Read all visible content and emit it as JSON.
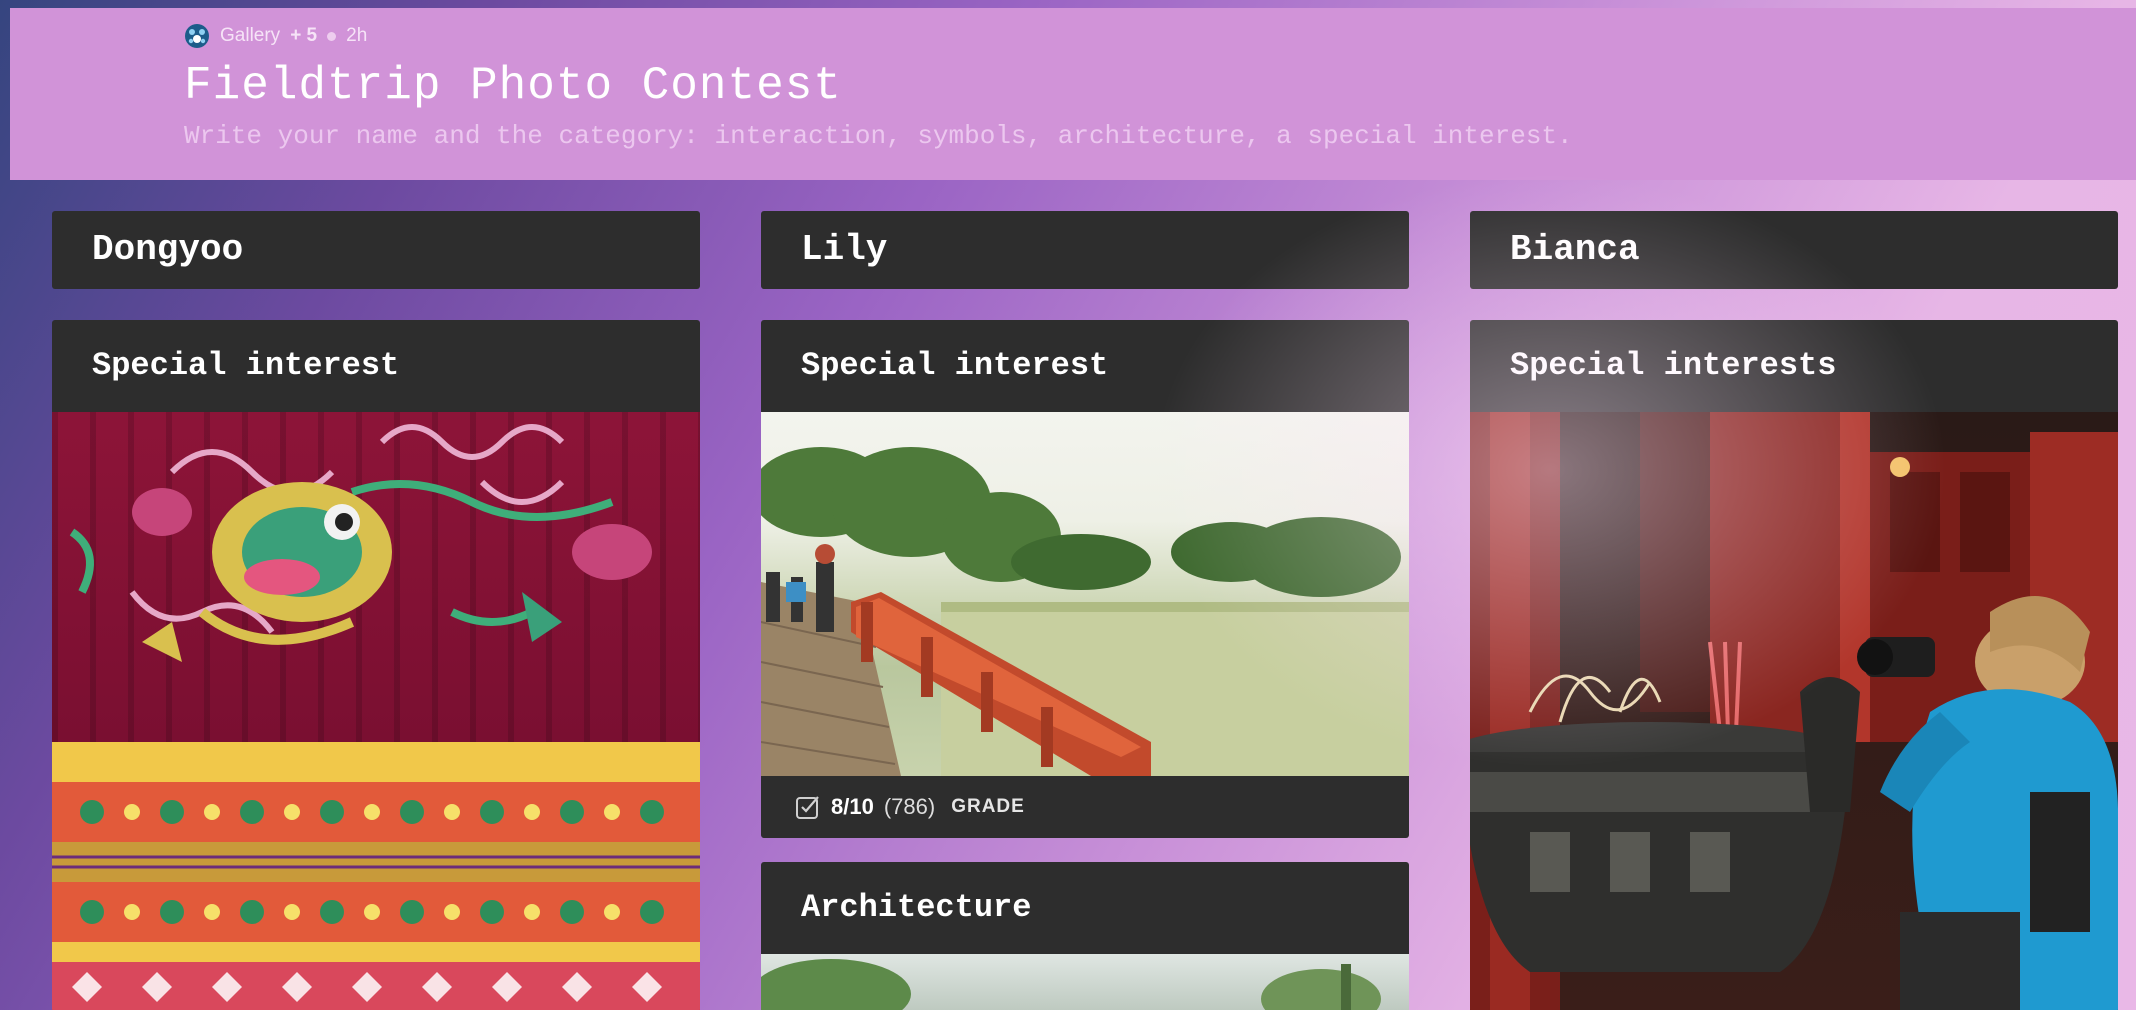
{
  "header": {
    "board_type": "Gallery",
    "contributors": "+ 5",
    "time_ago": "2h",
    "title": "Fieldtrip Photo Contest",
    "description": "Write your name and the category: interaction, symbols, architecture, a special interest.",
    "background_color": "#d193d8",
    "avatar_icon": "padlet-avatar-icon"
  },
  "columns": [
    {
      "name": "Dongyoo",
      "posts": [
        {
          "title": "Special interest",
          "image": "embroidered fabric with dragon pattern"
        }
      ]
    },
    {
      "name": "Lily",
      "posts": [
        {
          "title": "Special interest",
          "image": "red wooden bridge over a lake with trees",
          "grade": {
            "icon": "checkbox-icon",
            "score": "8/10",
            "votes": "(786)",
            "label": "GRADE"
          }
        },
        {
          "title": "Architecture",
          "image": "architecture photo (partially visible)"
        }
      ]
    },
    {
      "name": "Bianca",
      "posts": [
        {
          "title": "Special interests",
          "image": "person photographing incense burner at a temple"
        }
      ]
    }
  ],
  "colors": {
    "card": "#2d2d2d",
    "card_text": "#ffffff"
  }
}
